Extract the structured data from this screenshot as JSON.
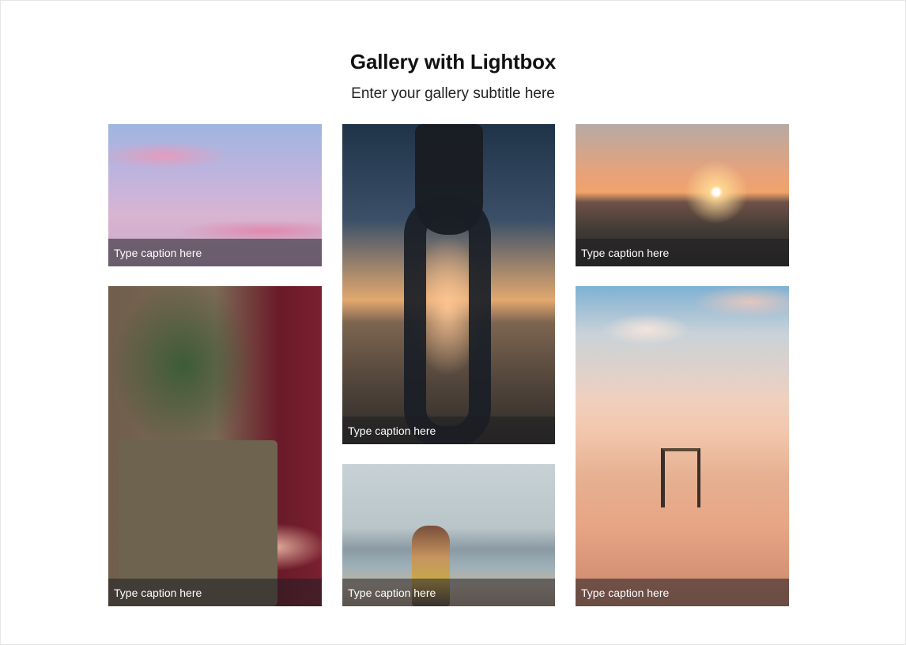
{
  "gallery": {
    "title": "Gallery with Lightbox",
    "subtitle": "Enter your gallery subtitle here",
    "items": [
      {
        "caption": "Type caption here",
        "subject": "pink sunset sky"
      },
      {
        "caption": "Type caption here",
        "subject": "lantern framing pier with ferris wheel"
      },
      {
        "caption": "Type caption here",
        "subject": "sun setting over mountains"
      },
      {
        "caption": "Type caption here",
        "subject": "plants in a canvas apron pocket"
      },
      {
        "caption": "Type caption here",
        "subject": "person with sailboard mast at lake"
      },
      {
        "caption": "Type caption here",
        "subject": "chair on beach at sunset"
      }
    ]
  }
}
